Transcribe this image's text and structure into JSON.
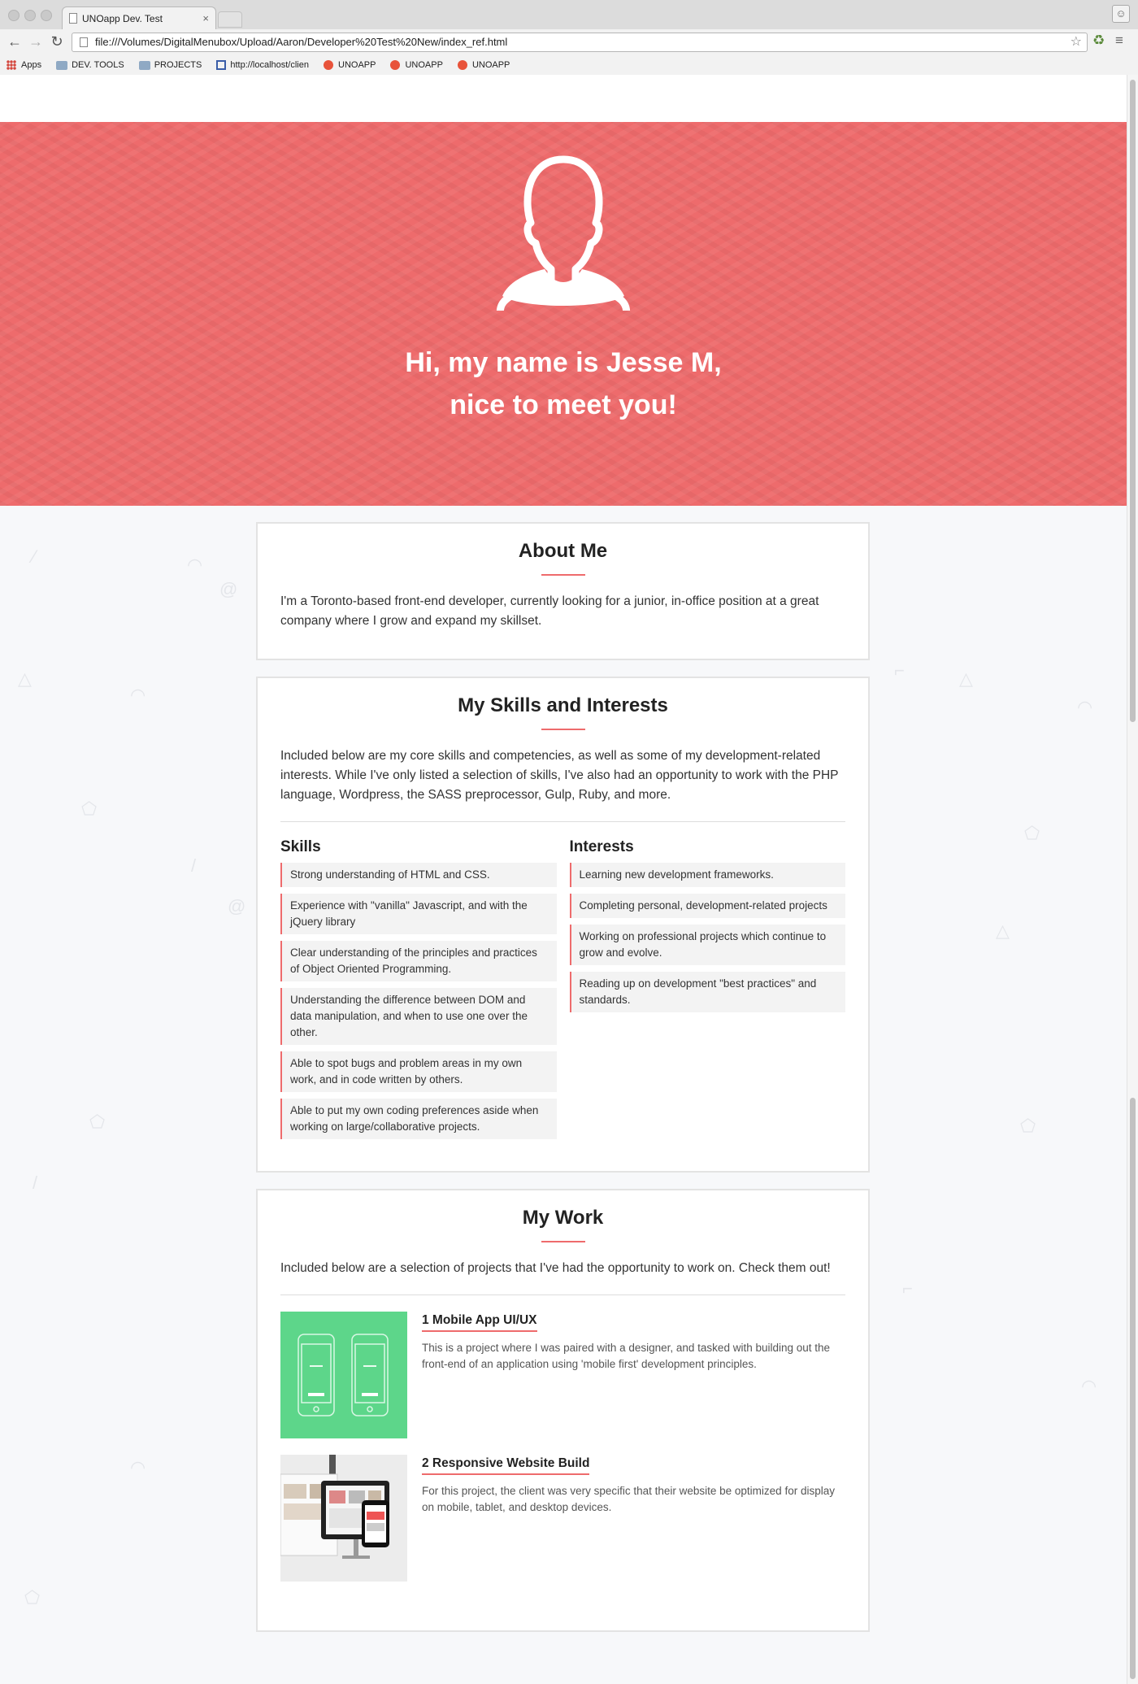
{
  "browser": {
    "tab_title": "UNOapp Dev. Test",
    "tab_close": "×",
    "url": "file:///Volumes/DigitalMenubox/Upload/Aaron/Developer%20Test%20New/index_ref.html",
    "bookmarks": [
      {
        "label": "Apps",
        "icon": "apps-grid-icon"
      },
      {
        "label": "DEV. TOOLS",
        "icon": "folder-icon"
      },
      {
        "label": "PROJECTS",
        "icon": "folder-icon"
      },
      {
        "label": "http://localhost/clien",
        "icon": "site-icon"
      },
      {
        "label": "UNOAPP",
        "icon": "unoapp-icon"
      },
      {
        "label": "UNOAPP",
        "icon": "unoapp-icon"
      },
      {
        "label": "UNOAPP",
        "icon": "unoapp-icon"
      }
    ]
  },
  "hero": {
    "line1": "Hi, my name is Jesse M,",
    "line2": "nice to meet you!",
    "bg_color": "#ee6b6c"
  },
  "about": {
    "title": "About Me",
    "text": "I'm a Toronto-based front-end developer, currently looking for a junior, in-office position at a great company where I grow and expand my skillset."
  },
  "skills": {
    "title": "My Skills and Interests",
    "text": "Included below are my core skills and competencies, as well as some of my development-related interests. While I've only listed a selection of skills, I've also had an opportunity to work with the PHP language, Wordpress, the SASS preprocessor, Gulp, Ruby, and more.",
    "skills_heading": "Skills",
    "skills_items": [
      "Strong understanding of HTML and CSS.",
      "Experience with \"vanilla\" Javascript, and with the jQuery library",
      "Clear understanding of the principles and practices of Object Oriented Programming.",
      "Understanding the difference between DOM and data manipulation, and when to use one over the other.",
      "Able to spot bugs and problem areas in my own work, and in code written by others.",
      "Able to put my own coding preferences aside when working on large/collaborative projects."
    ],
    "interests_heading": "Interests",
    "interests_items": [
      "Learning new development frameworks.",
      "Completing personal, development-related projects",
      "Working on professional projects which continue to grow and evolve.",
      "Reading up on development \"best practices\" and standards."
    ]
  },
  "work": {
    "title": "My Work",
    "text": "Included below are a selection of projects that I've had the opportunity to work on. Check them out!",
    "projects": [
      {
        "title": "1 Mobile App UI/UX",
        "text": "This is a project where I was paired with a designer, and tasked with building out the front-end of an application using 'mobile first' development principles.",
        "thumb_color": "#5dd68a"
      },
      {
        "title": "2 Responsive Website Build",
        "text": "For this project, the client was very specific that their website be optimized for display on mobile, tablet, and desktop devices.",
        "thumb_color": "#e9e9e9"
      }
    ]
  },
  "colors": {
    "accent": "#ee6b6c",
    "card_border": "#e3e3e3"
  }
}
